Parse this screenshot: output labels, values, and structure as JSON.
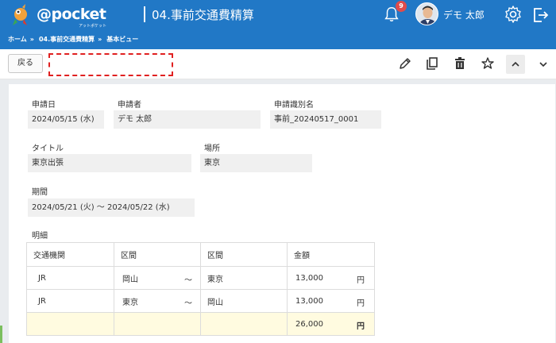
{
  "header": {
    "logo_text": "@pocket",
    "logo_sub": "アットポケット",
    "title": "04.事前交通費精算",
    "notification_count": "9",
    "user_name": "デモ 太郎"
  },
  "breadcrumb": [
    "ホーム",
    "04.事前交通費精算",
    "基本ビュー"
  ],
  "breadcrumb_sep": "»",
  "toolbar": {
    "back_label": "戻る"
  },
  "form": {
    "apply_date_label": "申請日",
    "apply_date_value": "2024/05/15 (水)",
    "applicant_label": "申請者",
    "applicant_value": "デモ 太郎",
    "request_id_label": "申請識別名",
    "request_id_value": "事前_20240517_0001",
    "title_label": "タイトル",
    "title_value": "東京出張",
    "place_label": "場所",
    "place_value": "東京",
    "period_label": "期間",
    "period_value": "2024/05/21 (火) ～ 2024/05/22 (水)",
    "details_label": "明細"
  },
  "table": {
    "headers": [
      "交通機関",
      "区間",
      "区間",
      "金額"
    ],
    "rows": [
      {
        "transport": "JR",
        "from": "岡山",
        "to": "東京",
        "amount": "13,000"
      },
      {
        "transport": "JR",
        "from": "東京",
        "to": "岡山",
        "amount": "13,000"
      }
    ],
    "tilde": "～",
    "yen": "円",
    "total": "26,000"
  },
  "colors": {
    "header_bg": "#2178c6",
    "field_bg": "#f0f0f0",
    "total_row_bg": "#fffbe0",
    "badge": "#e04c4c"
  },
  "icons": [
    "mascot-logo-icon",
    "bell-icon",
    "avatar",
    "gear-icon",
    "logout-icon",
    "pencil-icon",
    "copy-icon",
    "trash-icon",
    "star-icon",
    "chevron-up-icon",
    "chevron-down-icon"
  ]
}
